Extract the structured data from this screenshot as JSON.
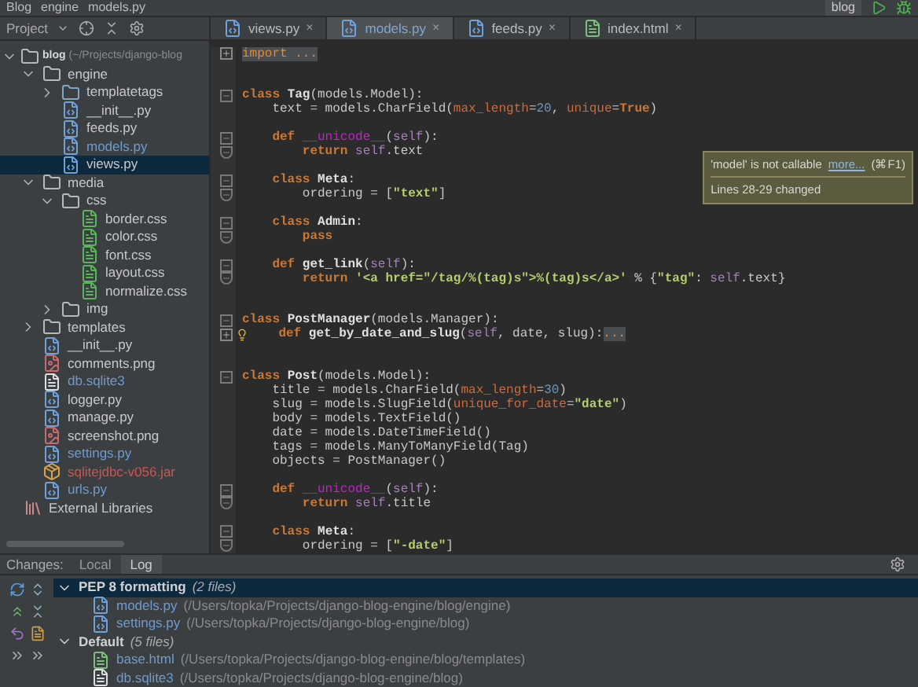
{
  "breadcrumbs": [
    "Blog",
    "engine",
    "models.py"
  ],
  "run_config": {
    "label": "blog"
  },
  "project_panel": {
    "title": "Project"
  },
  "tree": [
    {
      "name": "blog",
      "path": "(~/Projects/django-blog",
      "kind": "root",
      "expanded": true,
      "selected": false,
      "children": [
        {
          "name": "engine",
          "kind": "folder",
          "expanded": true,
          "selected": false,
          "children": [
            {
              "name": "templatetags",
              "kind": "package",
              "expanded": false,
              "selected": false
            },
            {
              "name": "__init__.py",
              "kind": "python",
              "selected": false
            },
            {
              "name": "feeds.py",
              "kind": "python",
              "selected": false
            },
            {
              "name": "models.py",
              "kind": "python",
              "selected": false,
              "color": "#6c9bd2"
            },
            {
              "name": "views.py",
              "kind": "python",
              "selected": true
            }
          ]
        },
        {
          "name": "media",
          "kind": "folder",
          "expanded": true,
          "selected": false,
          "children": [
            {
              "name": "css",
              "kind": "folder",
              "expanded": true,
              "selected": false,
              "children": [
                {
                  "name": "border.css",
                  "kind": "css",
                  "selected": false
                },
                {
                  "name": "color.css",
                  "kind": "css",
                  "selected": false
                },
                {
                  "name": "font.css",
                  "kind": "css",
                  "selected": false
                },
                {
                  "name": "layout.css",
                  "kind": "css",
                  "selected": false
                },
                {
                  "name": "normalize.css",
                  "kind": "css",
                  "selected": false
                }
              ]
            },
            {
              "name": "img",
              "kind": "folder",
              "expanded": false,
              "selected": false
            }
          ]
        },
        {
          "name": "templates",
          "kind": "folder",
          "expanded": false,
          "selected": false
        },
        {
          "name": "__init__.py",
          "kind": "python",
          "selected": false
        },
        {
          "name": "comments.png",
          "kind": "image",
          "selected": false
        },
        {
          "name": "db.sqlite3",
          "kind": "file",
          "selected": false,
          "color": "#6c9bd2"
        },
        {
          "name": "logger.py",
          "kind": "python",
          "selected": false
        },
        {
          "name": "manage.py",
          "kind": "python",
          "selected": false
        },
        {
          "name": "screenshot.png",
          "kind": "image",
          "selected": false
        },
        {
          "name": "settings.py",
          "kind": "python",
          "selected": false,
          "color": "#6c9bd2"
        },
        {
          "name": "sqlitejdbc-v056.jar",
          "kind": "jar",
          "selected": false,
          "color": "#d25252"
        },
        {
          "name": "urls.py",
          "kind": "python",
          "selected": false,
          "color": "#6c9bd2"
        }
      ]
    },
    {
      "name": "External Libraries",
      "kind": "library",
      "selected": false
    }
  ],
  "tabs": [
    {
      "label": "views.py",
      "kind": "python",
      "selected": false,
      "close": "×"
    },
    {
      "label": "models.py",
      "kind": "python",
      "selected": true,
      "close": "×"
    },
    {
      "label": "feeds.py",
      "kind": "python",
      "selected": false,
      "close": "×"
    },
    {
      "label": "index.html",
      "kind": "html",
      "selected": false,
      "close": "×"
    }
  ],
  "code": [
    {
      "kind": "code",
      "fold": {
        "kind": "collapsed"
      },
      "tokens": [
        {
          "kind": "folded",
          "text": "import ..."
        }
      ]
    },
    {
      "kind": "blank"
    },
    {
      "kind": "blank"
    },
    {
      "kind": "code",
      "fold": {
        "kind": "start"
      },
      "tokens": [
        {
          "kind": "keyword",
          "text": "class "
        },
        {
          "kind": "name",
          "text": "Tag"
        },
        {
          "kind": "plain",
          "text": "(models.Model):"
        }
      ]
    },
    {
      "kind": "code",
      "tokens": [
        {
          "kind": "plain",
          "text": "    text = models.CharField("
        },
        {
          "kind": "param",
          "text": "max_length"
        },
        {
          "kind": "plain",
          "text": "="
        },
        {
          "kind": "number",
          "text": "20"
        },
        {
          "kind": "plain",
          "text": ", "
        },
        {
          "kind": "param",
          "text": "unique"
        },
        {
          "kind": "plain",
          "text": "="
        },
        {
          "kind": "keyword",
          "text": "True"
        },
        {
          "kind": "plain",
          "text": ")"
        }
      ]
    },
    {
      "kind": "blank"
    },
    {
      "kind": "code",
      "fold": {
        "kind": "start"
      },
      "tokens": [
        {
          "kind": "keyword",
          "text": "    def "
        },
        {
          "kind": "magic",
          "text": "__unicode__"
        },
        {
          "kind": "plain",
          "text": "("
        },
        {
          "kind": "self",
          "text": "self"
        },
        {
          "kind": "plain",
          "text": "):"
        }
      ]
    },
    {
      "kind": "code",
      "fold": {
        "kind": "end"
      },
      "tokens": [
        {
          "kind": "keyword",
          "text": "        return "
        },
        {
          "kind": "self",
          "text": "self"
        },
        {
          "kind": "plain",
          "text": ".text"
        }
      ]
    },
    {
      "kind": "blank"
    },
    {
      "kind": "code",
      "fold": {
        "kind": "start"
      },
      "tokens": [
        {
          "kind": "keyword",
          "text": "    class "
        },
        {
          "kind": "name",
          "text": "Meta"
        },
        {
          "kind": "plain",
          "text": ":"
        }
      ]
    },
    {
      "kind": "code",
      "fold": {
        "kind": "end"
      },
      "tokens": [
        {
          "kind": "plain",
          "text": "        ordering = ["
        },
        {
          "kind": "string",
          "text": "\"text\""
        },
        {
          "kind": "plain",
          "text": "]"
        }
      ]
    },
    {
      "kind": "blank"
    },
    {
      "kind": "code",
      "fold": {
        "kind": "start"
      },
      "tokens": [
        {
          "kind": "keyword",
          "text": "    class "
        },
        {
          "kind": "name",
          "text": "Admin"
        },
        {
          "kind": "plain",
          "text": ":"
        }
      ]
    },
    {
      "kind": "code",
      "fold": {
        "kind": "end"
      },
      "tokens": [
        {
          "kind": "keyword",
          "text": "        pass"
        }
      ]
    },
    {
      "kind": "blank"
    },
    {
      "kind": "code",
      "fold": {
        "kind": "start"
      },
      "tokens": [
        {
          "kind": "keyword",
          "text": "    def "
        },
        {
          "kind": "name",
          "text": "get_link"
        },
        {
          "kind": "plain",
          "text": "("
        },
        {
          "kind": "self",
          "text": "self"
        },
        {
          "kind": "plain",
          "text": "):"
        }
      ]
    },
    {
      "kind": "code",
      "fold": {
        "kind": "end"
      },
      "tokens": [
        {
          "kind": "keyword",
          "text": "        return "
        },
        {
          "kind": "string",
          "text": "'<a href=\"/tag/%(tag)s\">%(tag)s</a>'"
        },
        {
          "kind": "plain",
          "text": " % {"
        },
        {
          "kind": "string",
          "text": "\"tag\""
        },
        {
          "kind": "plain",
          "text": ": "
        },
        {
          "kind": "self",
          "text": "self"
        },
        {
          "kind": "plain",
          "text": ".text}"
        }
      ]
    },
    {
      "kind": "blank"
    },
    {
      "kind": "blank"
    },
    {
      "kind": "code",
      "fold": {
        "kind": "start"
      },
      "tokens": [
        {
          "kind": "keyword",
          "text": "class "
        },
        {
          "kind": "name",
          "text": "PostManager"
        },
        {
          "kind": "plain",
          "text": "(models.Manager):"
        }
      ]
    },
    {
      "kind": "code",
      "fold": {
        "kind": "collapsed"
      },
      "hint": true,
      "tokens": [
        {
          "kind": "keyword",
          "text": "    def "
        },
        {
          "kind": "name",
          "text": "get_by_date_and_slug"
        },
        {
          "kind": "plain",
          "text": "("
        },
        {
          "kind": "self",
          "text": "self"
        },
        {
          "kind": "plain",
          "text": ", date, slug):"
        },
        {
          "kind": "folded",
          "text": "..."
        }
      ]
    },
    {
      "kind": "blank"
    },
    {
      "kind": "blank"
    },
    {
      "kind": "code",
      "fold": {
        "kind": "start"
      },
      "tokens": [
        {
          "kind": "keyword",
          "text": "class "
        },
        {
          "kind": "name",
          "text": "Post"
        },
        {
          "kind": "plain",
          "text": "(models.Model):"
        }
      ]
    },
    {
      "kind": "code",
      "tokens": [
        {
          "kind": "plain",
          "text": "    title = models.CharField("
        },
        {
          "kind": "param",
          "text": "max_length"
        },
        {
          "kind": "plain",
          "text": "="
        },
        {
          "kind": "number",
          "text": "30"
        },
        {
          "kind": "plain",
          "text": ")"
        }
      ]
    },
    {
      "kind": "code",
      "tokens": [
        {
          "kind": "plain",
          "text": "    slug = models.SlugField("
        },
        {
          "kind": "param",
          "text": "unique_for_date"
        },
        {
          "kind": "plain",
          "text": "="
        },
        {
          "kind": "string",
          "text": "\"date\""
        },
        {
          "kind": "plain",
          "text": ")"
        }
      ]
    },
    {
      "kind": "code",
      "tokens": [
        {
          "kind": "plain",
          "text": "    body = models.TextField()"
        }
      ]
    },
    {
      "kind": "code",
      "tokens": [
        {
          "kind": "plain",
          "text": "    date = models.DateTimeField()"
        }
      ]
    },
    {
      "kind": "code",
      "tokens": [
        {
          "kind": "plain",
          "text": "    tags = models.ManyToManyField(Tag)"
        }
      ]
    },
    {
      "kind": "code",
      "tokens": [
        {
          "kind": "plain",
          "text": "    objects = PostManager()"
        }
      ]
    },
    {
      "kind": "blank"
    },
    {
      "kind": "code",
      "fold": {
        "kind": "start"
      },
      "tokens": [
        {
          "kind": "keyword",
          "text": "    def "
        },
        {
          "kind": "magic",
          "text": "__unicode__"
        },
        {
          "kind": "plain",
          "text": "("
        },
        {
          "kind": "self",
          "text": "self"
        },
        {
          "kind": "plain",
          "text": "):"
        }
      ]
    },
    {
      "kind": "code",
      "fold": {
        "kind": "end"
      },
      "tokens": [
        {
          "kind": "keyword",
          "text": "        return "
        },
        {
          "kind": "self",
          "text": "self"
        },
        {
          "kind": "plain",
          "text": ".title"
        }
      ]
    },
    {
      "kind": "blank"
    },
    {
      "kind": "code",
      "fold": {
        "kind": "start"
      },
      "tokens": [
        {
          "kind": "keyword",
          "text": "    class "
        },
        {
          "kind": "name",
          "text": "Meta"
        },
        {
          "kind": "plain",
          "text": ":"
        }
      ]
    },
    {
      "kind": "code",
      "fold": {
        "kind": "end"
      },
      "tokens": [
        {
          "kind": "plain",
          "text": "        ordering = ["
        },
        {
          "kind": "string",
          "text": "\"-date\""
        },
        {
          "kind": "plain",
          "text": "]"
        }
      ]
    }
  ],
  "tooltip": {
    "message": "'model' is not callable",
    "link": "more...",
    "shortcut": "(⌘F1)",
    "note": "Lines 28-29 changed"
  },
  "changes": {
    "title": "Changes:",
    "tabs": [
      {
        "label": "Local",
        "selected": false
      },
      {
        "label": "Log",
        "selected": true
      }
    ],
    "lists": [
      {
        "name": "PEP 8 formatting",
        "count": "(2 files)",
        "expanded": true,
        "selected": true,
        "files": [
          {
            "name": "models.py",
            "kind": "python",
            "path": "(/Users/topka/Projects/django-blog-engine/blog/engine)"
          },
          {
            "name": "settings.py",
            "kind": "python",
            "path": "(/Users/topka/Projects/django-blog-engine/blog)"
          }
        ]
      },
      {
        "name": "Default",
        "count": "(5 files)",
        "expanded": true,
        "selected": false,
        "files": [
          {
            "name": "base.html",
            "kind": "html",
            "path": "(/Users/topka/Projects/django-blog-engine/blog/templates)"
          },
          {
            "name": "db.sqlite3",
            "kind": "file",
            "path": "(/Users/topka/Projects/django-blog-engine/blog)"
          }
        ]
      }
    ]
  }
}
